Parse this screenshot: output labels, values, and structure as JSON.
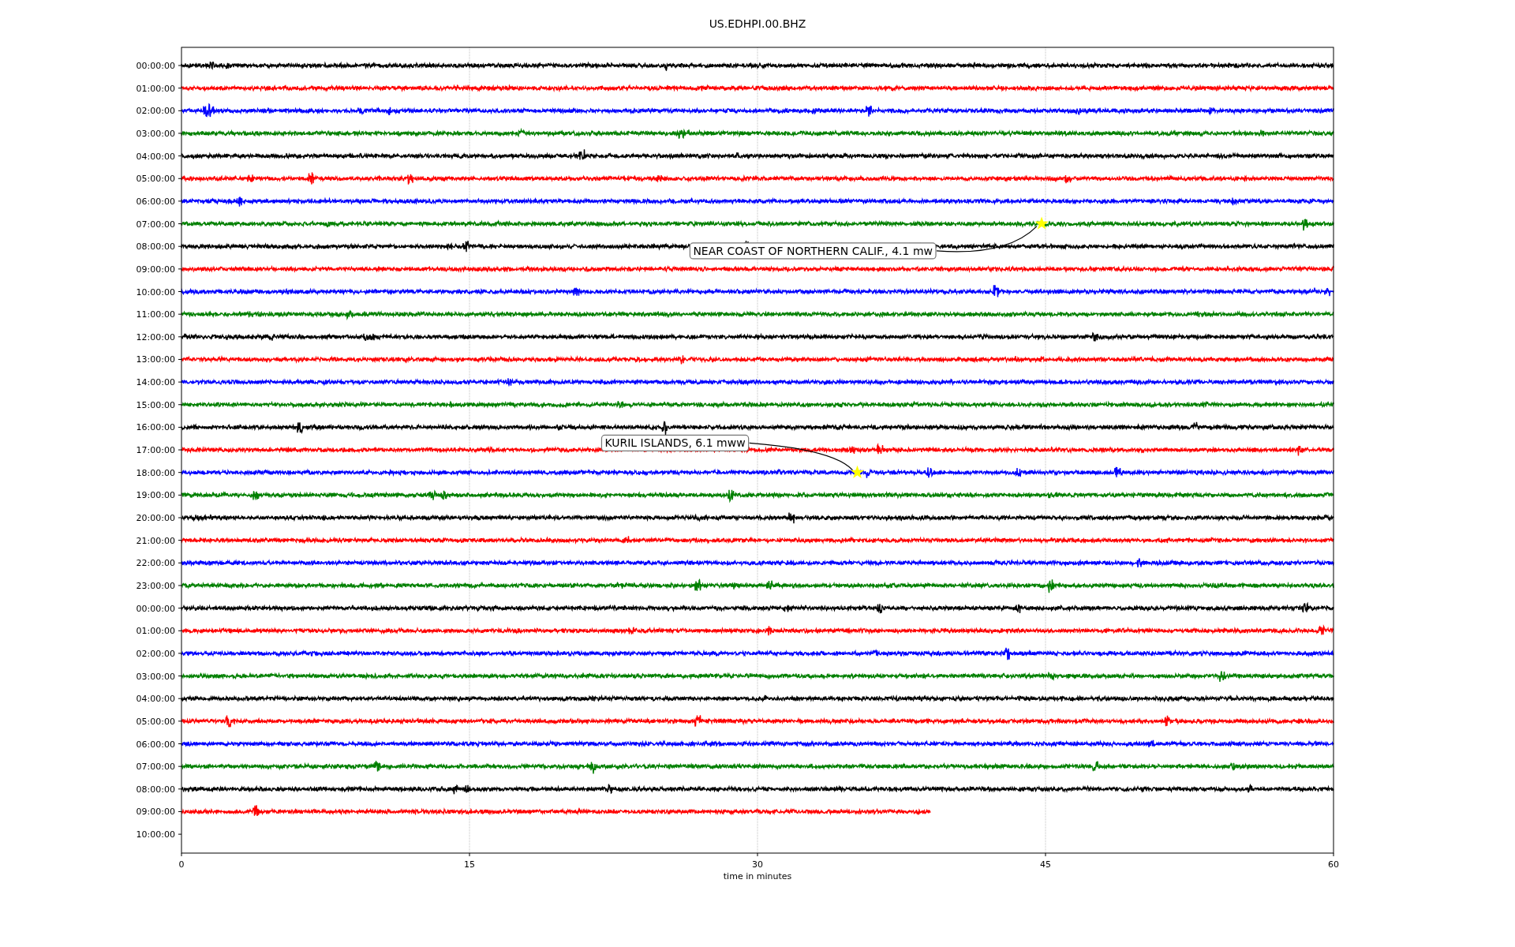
{
  "plot": {
    "title": "US.EDHPI.00.BHZ",
    "x_axis_label": "time in minutes",
    "x_tick_labels": [
      "0",
      "15",
      "30",
      "45",
      "60"
    ],
    "y_tick_labels": [
      "00:00:00",
      "01:00:00",
      "02:00:00",
      "03:00:00",
      "04:00:00",
      "05:00:00",
      "06:00:00",
      "07:00:00",
      "08:00:00",
      "09:00:00",
      "10:00:00",
      "11:00:00",
      "12:00:00",
      "13:00:00",
      "14:00:00",
      "15:00:00",
      "16:00:00",
      "17:00:00",
      "18:00:00",
      "19:00:00",
      "20:00:00",
      "21:00:00",
      "22:00:00",
      "23:00:00",
      "00:00:00",
      "01:00:00",
      "02:00:00",
      "03:00:00",
      "04:00:00",
      "05:00:00",
      "06:00:00",
      "07:00:00",
      "08:00:00",
      "09:00:00",
      "10:00:00"
    ],
    "traces": [
      {
        "color": "#000000",
        "partial": false
      },
      {
        "color": "#ff0000",
        "partial": false
      },
      {
        "color": "#0000ff",
        "partial": false
      },
      {
        "color": "#008000",
        "partial": false
      },
      {
        "color": "#000000",
        "partial": false
      },
      {
        "color": "#ff0000",
        "partial": false
      },
      {
        "color": "#0000ff",
        "partial": false
      },
      {
        "color": "#008000",
        "partial": false
      },
      {
        "color": "#000000",
        "partial": false
      },
      {
        "color": "#ff0000",
        "partial": false
      },
      {
        "color": "#0000ff",
        "partial": false
      },
      {
        "color": "#008000",
        "partial": false
      },
      {
        "color": "#000000",
        "partial": false
      },
      {
        "color": "#ff0000",
        "partial": false
      },
      {
        "color": "#0000ff",
        "partial": false
      },
      {
        "color": "#008000",
        "partial": false
      },
      {
        "color": "#000000",
        "partial": false
      },
      {
        "color": "#ff0000",
        "partial": false
      },
      {
        "color": "#0000ff",
        "partial": false
      },
      {
        "color": "#008000",
        "partial": false
      },
      {
        "color": "#000000",
        "partial": false
      },
      {
        "color": "#ff0000",
        "partial": false
      },
      {
        "color": "#0000ff",
        "partial": false
      },
      {
        "color": "#008000",
        "partial": false
      },
      {
        "color": "#000000",
        "partial": false
      },
      {
        "color": "#ff0000",
        "partial": false
      },
      {
        "color": "#0000ff",
        "partial": false
      },
      {
        "color": "#008000",
        "partial": false
      },
      {
        "color": "#000000",
        "partial": false
      },
      {
        "color": "#ff0000",
        "partial": false
      },
      {
        "color": "#0000ff",
        "partial": false
      },
      {
        "color": "#008000",
        "partial": false
      },
      {
        "color": "#000000",
        "partial": false
      },
      {
        "color": "#ff0000",
        "partial": true
      }
    ],
    "events": [
      {
        "label": "NEAR COAST OF NORTHERN CALIF., 4.1 mw"
      },
      {
        "label": "KURIL ISLANDS, 6.1 mww"
      }
    ]
  }
}
